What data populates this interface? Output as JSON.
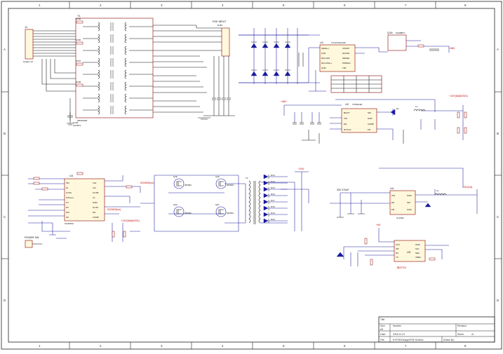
{
  "frame": {
    "col_labels": [
      "1",
      "2",
      "3",
      "4",
      "5",
      "6",
      "7",
      "8"
    ],
    "row_labels": [
      "A",
      "B",
      "C",
      "D"
    ]
  },
  "connector_j1": {
    "ref": "J1",
    "part": "Header 12"
  },
  "transformer_block": {
    "ref": "T1",
    "part": "HR601682",
    "resistors": [
      "R155",
      "R156",
      "R157",
      "R158"
    ],
    "resistors_bottom": [
      "R159",
      "R160"
    ],
    "cap": "C100",
    "cap_value": "102/2KV"
  },
  "poe_input": {
    "label": "POE INPUT",
    "ref": "RJ45"
  },
  "poe_ctrl": {
    "ref": "U1",
    "part": "LTC4279ACMS",
    "pins_left": [
      "ISEN(+)",
      "ACR",
      "RCLASS",
      "RCLASS++",
      "GND"
    ],
    "pins_right": [
      "VPORT",
      "NGATE",
      "SENSE",
      "PWRGD",
      "T2P"
    ]
  },
  "fet_top": {
    "ref": "Q16",
    "part": "Si4488DY"
  },
  "vout_label": "+48V",
  "buck": {
    "ref": "U2",
    "part": "TPS54160",
    "pins_left": [
      "BOOT",
      "VIN",
      "EN",
      "RT/CLK"
    ],
    "pins_right": [
      "SW",
      "GND",
      "COMP",
      "FB"
    ],
    "vin_label": "+48V",
    "vout_label": "+12V(6A@2021)",
    "inductor": "L1",
    "diode": "D1"
  },
  "pwm_ctrl": {
    "ref": "U3",
    "part": "SG3525A",
    "pins_left": [
      "INV",
      "NI",
      "SYNC",
      "OSCout",
      "CT",
      "RT",
      "DIS",
      "SS"
    ],
    "pins_right": [
      "Vref",
      "Vcc",
      "OUTB",
      "Vc",
      "GND",
      "OUTA",
      "SD",
      "COMP"
    ],
    "note_a": "SG3525(vn)",
    "note_b": "SG3525(vn)",
    "supply_label": "+12V(6A@2021)"
  },
  "bridge": {
    "fets": [
      "Q18",
      "Q19",
      "Q20",
      "Q21"
    ],
    "fet_part": "IRF840",
    "xfmr_ref": "T2",
    "diodes": [
      "D13",
      "D14",
      "D15",
      "D16",
      "D17",
      "D18",
      "D19",
      "D20"
    ],
    "out_label": "+24V"
  },
  "power_sw": {
    "label": "POWER SW"
  },
  "ldo": {
    "ref": "U4",
    "part": "XL1509",
    "pins_left": [
      "VIN",
      "EN",
      "FB"
    ],
    "pins_right": [
      "GND",
      "SW",
      "GND"
    ],
    "vin_label": "25V 470uF",
    "vout_label": "+5V(1A)",
    "inductor": "L2"
  },
  "mcu": {
    "ref": "U5",
    "part": "JB22701",
    "pins_left": [
      "VCC",
      "INT",
      "RX",
      "TX"
    ],
    "pins_right": [
      "GND",
      "SCL",
      "SDA",
      "VREF"
    ],
    "vin_label": "+5V"
  },
  "title_block": {
    "title_label": "Title",
    "size_label": "Size",
    "size_value": "A3",
    "number_label": "Number",
    "revision_label": "Revision",
    "date_label": "Date:",
    "date_value": "2018-11-21",
    "file_label": "File:",
    "file_value": "E:\\POE\\Design\\POE.SchDoc",
    "sheet_label": "Sheet",
    "sheet_value": "of",
    "drawn_label": "Drawn By:"
  }
}
